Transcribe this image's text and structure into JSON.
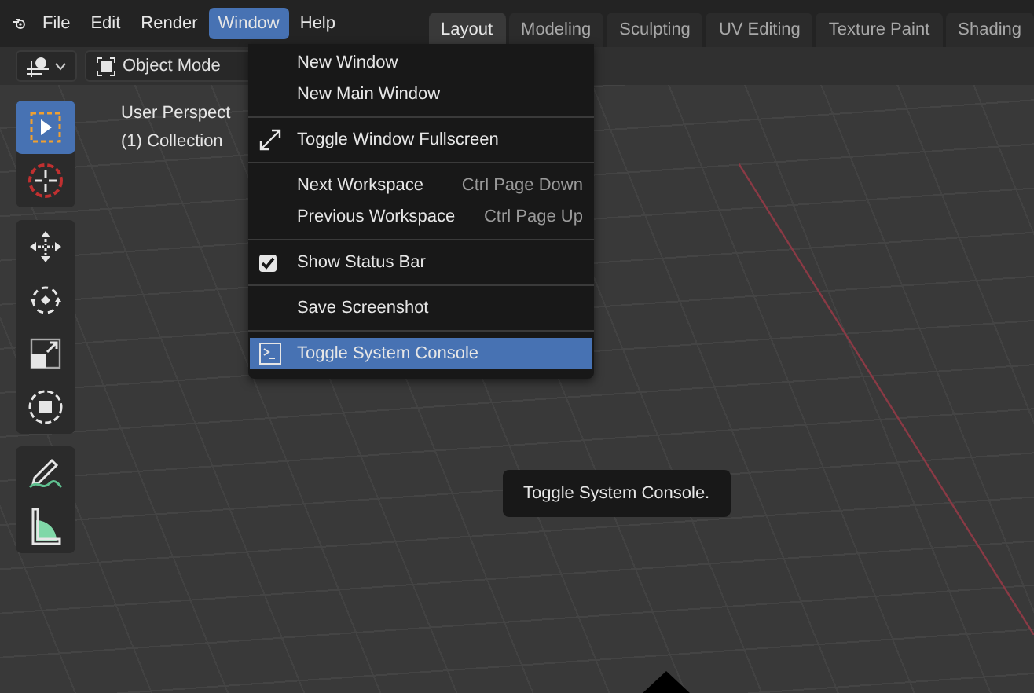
{
  "menubar": {
    "items": [
      {
        "label": "File",
        "selected": false
      },
      {
        "label": "Edit",
        "selected": false
      },
      {
        "label": "Render",
        "selected": false
      },
      {
        "label": "Window",
        "selected": true
      },
      {
        "label": "Help",
        "selected": false
      }
    ]
  },
  "workspace_tabs": [
    {
      "label": "Layout",
      "selected": true
    },
    {
      "label": "Modeling",
      "selected": false
    },
    {
      "label": "Sculpting",
      "selected": false
    },
    {
      "label": "UV Editing",
      "selected": false
    },
    {
      "label": "Texture Paint",
      "selected": false
    },
    {
      "label": "Shading",
      "selected": false
    }
  ],
  "header": {
    "mode": "Object Mode"
  },
  "viewport": {
    "info": [
      "User Perspect",
      "(1) Collection"
    ]
  },
  "toolbar": [
    [
      {
        "kind": "select-box",
        "selected": true
      },
      {
        "kind": "cursor",
        "selected": false
      }
    ],
    [
      {
        "kind": "move",
        "selected": false
      },
      {
        "kind": "rotate",
        "selected": false
      },
      {
        "kind": "scale",
        "selected": false
      },
      {
        "kind": "transform",
        "selected": false
      }
    ],
    [
      {
        "kind": "annotate",
        "selected": false
      },
      {
        "kind": "measure",
        "selected": false
      }
    ]
  ],
  "window_menu": [
    [
      {
        "kind": "plain",
        "label": "New Window",
        "selected": false
      },
      {
        "kind": "plain",
        "label": "New Main Window",
        "selected": false
      }
    ],
    [
      {
        "kind": "fullscreen",
        "label": "Toggle Window Fullscreen",
        "selected": false
      }
    ],
    [
      {
        "kind": "plain",
        "label": "Next Workspace",
        "shortcut": "Ctrl Page Down",
        "selected": false
      },
      {
        "kind": "plain",
        "label": "Previous Workspace",
        "shortcut": "Ctrl Page Up",
        "selected": false
      }
    ],
    [
      {
        "kind": "check",
        "label": "Show Status Bar",
        "checked": true,
        "selected": false
      }
    ],
    [
      {
        "kind": "plain",
        "label": "Save Screenshot",
        "selected": false
      }
    ],
    [
      {
        "kind": "console",
        "label": "Toggle System Console",
        "selected": true
      }
    ]
  ],
  "tooltip": "Toggle System Console."
}
